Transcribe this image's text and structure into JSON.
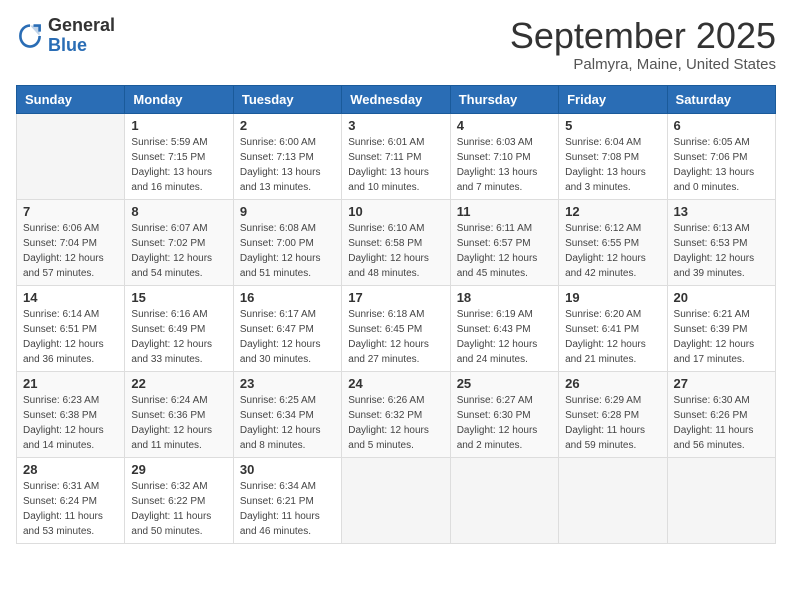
{
  "logo": {
    "general": "General",
    "blue": "Blue"
  },
  "header": {
    "month": "September 2025",
    "location": "Palmyra, Maine, United States"
  },
  "weekdays": [
    "Sunday",
    "Monday",
    "Tuesday",
    "Wednesday",
    "Thursday",
    "Friday",
    "Saturday"
  ],
  "weeks": [
    [
      {
        "day": "",
        "sunrise": "",
        "sunset": "",
        "daylight": ""
      },
      {
        "day": "1",
        "sunrise": "Sunrise: 5:59 AM",
        "sunset": "Sunset: 7:15 PM",
        "daylight": "Daylight: 13 hours and 16 minutes."
      },
      {
        "day": "2",
        "sunrise": "Sunrise: 6:00 AM",
        "sunset": "Sunset: 7:13 PM",
        "daylight": "Daylight: 13 hours and 13 minutes."
      },
      {
        "day": "3",
        "sunrise": "Sunrise: 6:01 AM",
        "sunset": "Sunset: 7:11 PM",
        "daylight": "Daylight: 13 hours and 10 minutes."
      },
      {
        "day": "4",
        "sunrise": "Sunrise: 6:03 AM",
        "sunset": "Sunset: 7:10 PM",
        "daylight": "Daylight: 13 hours and 7 minutes."
      },
      {
        "day": "5",
        "sunrise": "Sunrise: 6:04 AM",
        "sunset": "Sunset: 7:08 PM",
        "daylight": "Daylight: 13 hours and 3 minutes."
      },
      {
        "day": "6",
        "sunrise": "Sunrise: 6:05 AM",
        "sunset": "Sunset: 7:06 PM",
        "daylight": "Daylight: 13 hours and 0 minutes."
      }
    ],
    [
      {
        "day": "7",
        "sunrise": "Sunrise: 6:06 AM",
        "sunset": "Sunset: 7:04 PM",
        "daylight": "Daylight: 12 hours and 57 minutes."
      },
      {
        "day": "8",
        "sunrise": "Sunrise: 6:07 AM",
        "sunset": "Sunset: 7:02 PM",
        "daylight": "Daylight: 12 hours and 54 minutes."
      },
      {
        "day": "9",
        "sunrise": "Sunrise: 6:08 AM",
        "sunset": "Sunset: 7:00 PM",
        "daylight": "Daylight: 12 hours and 51 minutes."
      },
      {
        "day": "10",
        "sunrise": "Sunrise: 6:10 AM",
        "sunset": "Sunset: 6:58 PM",
        "daylight": "Daylight: 12 hours and 48 minutes."
      },
      {
        "day": "11",
        "sunrise": "Sunrise: 6:11 AM",
        "sunset": "Sunset: 6:57 PM",
        "daylight": "Daylight: 12 hours and 45 minutes."
      },
      {
        "day": "12",
        "sunrise": "Sunrise: 6:12 AM",
        "sunset": "Sunset: 6:55 PM",
        "daylight": "Daylight: 12 hours and 42 minutes."
      },
      {
        "day": "13",
        "sunrise": "Sunrise: 6:13 AM",
        "sunset": "Sunset: 6:53 PM",
        "daylight": "Daylight: 12 hours and 39 minutes."
      }
    ],
    [
      {
        "day": "14",
        "sunrise": "Sunrise: 6:14 AM",
        "sunset": "Sunset: 6:51 PM",
        "daylight": "Daylight: 12 hours and 36 minutes."
      },
      {
        "day": "15",
        "sunrise": "Sunrise: 6:16 AM",
        "sunset": "Sunset: 6:49 PM",
        "daylight": "Daylight: 12 hours and 33 minutes."
      },
      {
        "day": "16",
        "sunrise": "Sunrise: 6:17 AM",
        "sunset": "Sunset: 6:47 PM",
        "daylight": "Daylight: 12 hours and 30 minutes."
      },
      {
        "day": "17",
        "sunrise": "Sunrise: 6:18 AM",
        "sunset": "Sunset: 6:45 PM",
        "daylight": "Daylight: 12 hours and 27 minutes."
      },
      {
        "day": "18",
        "sunrise": "Sunrise: 6:19 AM",
        "sunset": "Sunset: 6:43 PM",
        "daylight": "Daylight: 12 hours and 24 minutes."
      },
      {
        "day": "19",
        "sunrise": "Sunrise: 6:20 AM",
        "sunset": "Sunset: 6:41 PM",
        "daylight": "Daylight: 12 hours and 21 minutes."
      },
      {
        "day": "20",
        "sunrise": "Sunrise: 6:21 AM",
        "sunset": "Sunset: 6:39 PM",
        "daylight": "Daylight: 12 hours and 17 minutes."
      }
    ],
    [
      {
        "day": "21",
        "sunrise": "Sunrise: 6:23 AM",
        "sunset": "Sunset: 6:38 PM",
        "daylight": "Daylight: 12 hours and 14 minutes."
      },
      {
        "day": "22",
        "sunrise": "Sunrise: 6:24 AM",
        "sunset": "Sunset: 6:36 PM",
        "daylight": "Daylight: 12 hours and 11 minutes."
      },
      {
        "day": "23",
        "sunrise": "Sunrise: 6:25 AM",
        "sunset": "Sunset: 6:34 PM",
        "daylight": "Daylight: 12 hours and 8 minutes."
      },
      {
        "day": "24",
        "sunrise": "Sunrise: 6:26 AM",
        "sunset": "Sunset: 6:32 PM",
        "daylight": "Daylight: 12 hours and 5 minutes."
      },
      {
        "day": "25",
        "sunrise": "Sunrise: 6:27 AM",
        "sunset": "Sunset: 6:30 PM",
        "daylight": "Daylight: 12 hours and 2 minutes."
      },
      {
        "day": "26",
        "sunrise": "Sunrise: 6:29 AM",
        "sunset": "Sunset: 6:28 PM",
        "daylight": "Daylight: 11 hours and 59 minutes."
      },
      {
        "day": "27",
        "sunrise": "Sunrise: 6:30 AM",
        "sunset": "Sunset: 6:26 PM",
        "daylight": "Daylight: 11 hours and 56 minutes."
      }
    ],
    [
      {
        "day": "28",
        "sunrise": "Sunrise: 6:31 AM",
        "sunset": "Sunset: 6:24 PM",
        "daylight": "Daylight: 11 hours and 53 minutes."
      },
      {
        "day": "29",
        "sunrise": "Sunrise: 6:32 AM",
        "sunset": "Sunset: 6:22 PM",
        "daylight": "Daylight: 11 hours and 50 minutes."
      },
      {
        "day": "30",
        "sunrise": "Sunrise: 6:34 AM",
        "sunset": "Sunset: 6:21 PM",
        "daylight": "Daylight: 11 hours and 46 minutes."
      },
      {
        "day": "",
        "sunrise": "",
        "sunset": "",
        "daylight": ""
      },
      {
        "day": "",
        "sunrise": "",
        "sunset": "",
        "daylight": ""
      },
      {
        "day": "",
        "sunrise": "",
        "sunset": "",
        "daylight": ""
      },
      {
        "day": "",
        "sunrise": "",
        "sunset": "",
        "daylight": ""
      }
    ]
  ]
}
